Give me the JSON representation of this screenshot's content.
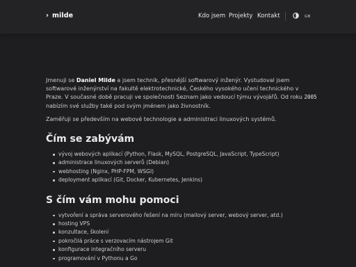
{
  "header": {
    "brand": "milde",
    "nav": [
      "Kdo jsem",
      "Projekty",
      "Kontakt"
    ],
    "lang": "GB",
    "theme_icon": "half-circle-contrast-icon"
  },
  "intro": {
    "p1_a": "Jmenuji se ",
    "name": "Daniel Milde",
    "p1_b": " a jsem technik, přesnější softwarový inženýr. Vystudoval jsem softwarové inženýrství na fakultě elektrotechnické, Českého vysokého učení technického v Praze. V současné době pracuji ve společnosti Seznam jako vedoucí týmu vývojářů. Od roku ",
    "year": "2005",
    "p1_c": " nabízím své služby také pod svým jménem jako živnostník.",
    "p2": "Zaměřuji se především na webové technologie a administraci linuxových systémů."
  },
  "section1": {
    "title": "Čím se zabývám",
    "items": [
      "vývoj webových aplikací (Python, Flask, MySQL, PostgreSQL, JavaScript, TypeScript)",
      "administrace linuxových serverů (Debian)",
      "webhosting (Nginx, PHP-FPM, WSGI)",
      "deployment aplikací (Git, Docker, Kubernetes, Jenkins)"
    ]
  },
  "section2": {
    "title": "S čím vám mohu pomoci",
    "items": [
      "vytvoření a správa serverového řešení na míru (mailový server, webový server, atd.)",
      "hosting VPS",
      "konzultace, školení",
      "pokročilá práce s verzovacím nástrojem Git",
      "konfigurace integračního serveru",
      "programování v Pythonu a Go"
    ]
  },
  "colors": {
    "background": "#1e1e20",
    "header": "#232326",
    "text": "#cfcfcf",
    "heading": "#e9e9e9"
  }
}
